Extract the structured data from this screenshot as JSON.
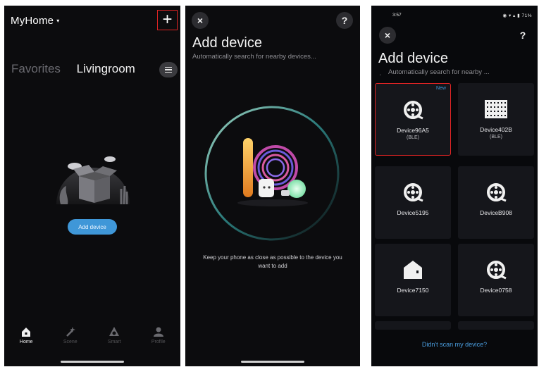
{
  "phone1": {
    "home_label": "MyHome",
    "caret": "▾",
    "plus": "+",
    "tabs": {
      "favorites": "Favorites",
      "livingroom": "Livingroom"
    },
    "add_device": "Add device",
    "nav": [
      {
        "label": "Home",
        "icon": "home-icon"
      },
      {
        "label": "Scene",
        "icon": "magic-wand-icon"
      },
      {
        "label": "Smart",
        "icon": "smart-icon"
      },
      {
        "label": "Profile",
        "icon": "profile-icon"
      }
    ]
  },
  "phone2": {
    "close": "×",
    "help": "?",
    "title": "Add device",
    "subtitle": "Automatically search for nearby devices...",
    "hint": "Keep your phone as close as possible to the device you want to add"
  },
  "phone3": {
    "status_time": "3:57",
    "status_right": "71%",
    "close": "×",
    "help": "?",
    "title": "Add device",
    "subtitle": "Automatically search for nearby ...",
    "devices": [
      {
        "name": "Device96A5",
        "sub": "(BLE)",
        "badge": "New",
        "icon": "led-strip-icon"
      },
      {
        "name": "Device402B",
        "sub": "(BLE)",
        "badge": "",
        "icon": "led-panel-icon"
      },
      {
        "name": "Device5195",
        "sub": "",
        "badge": "",
        "icon": "led-strip-icon"
      },
      {
        "name": "DeviceB908",
        "sub": "",
        "badge": "",
        "icon": "led-strip-icon"
      },
      {
        "name": "Device7150",
        "sub": "",
        "badge": "",
        "icon": "smart-plug-icon"
      },
      {
        "name": "Device0758",
        "sub": "",
        "badge": "",
        "icon": "led-strip-icon"
      }
    ],
    "link": "Didn't scan my device?"
  },
  "colors": {
    "accent": "#3f97d8",
    "highlight": "#e02424",
    "background": "#0c0c0e"
  }
}
